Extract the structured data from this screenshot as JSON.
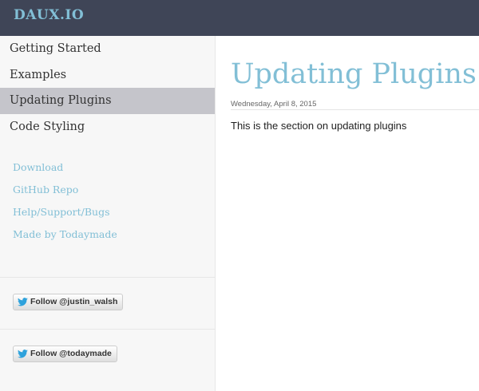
{
  "header": {
    "brand": "DAUX.IO"
  },
  "sidebar": {
    "nav": [
      {
        "label": "Getting Started",
        "active": false
      },
      {
        "label": "Examples",
        "active": false
      },
      {
        "label": "Updating Plugins",
        "active": true
      },
      {
        "label": "Code Styling",
        "active": false
      }
    ],
    "links": [
      {
        "label": "Download"
      },
      {
        "label": "GitHub Repo"
      },
      {
        "label": "Help/Support/Bugs"
      },
      {
        "label": "Made by Todaymade"
      }
    ],
    "follow_buttons": [
      {
        "label": "Follow @justin_walsh",
        "icon": "twitter-bird-icon"
      },
      {
        "label": "Follow @todaymade",
        "icon": "twitter-bird-icon"
      }
    ]
  },
  "page": {
    "title": "Updating Plugins",
    "date": "Wednesday, April 8, 2015",
    "body": "This is the section on updating plugins"
  },
  "colors": {
    "header_bg": "#3f4557",
    "accent": "#82bfd6",
    "sidebar_bg": "#f7f7f7",
    "active_item_bg": "#c5c5cb",
    "twitter_blue": "#2ea2dc"
  }
}
